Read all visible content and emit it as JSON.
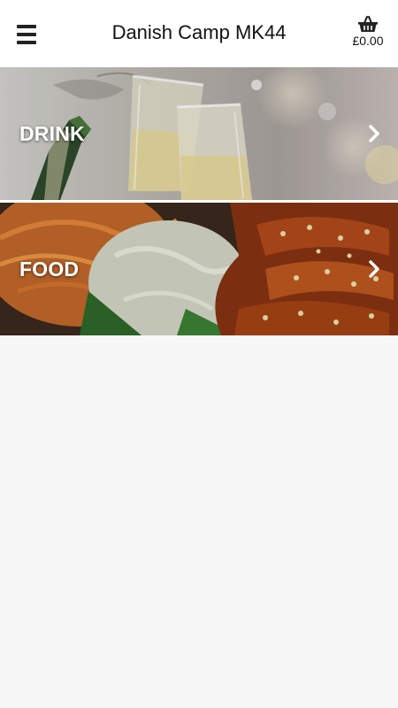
{
  "header": {
    "title": "Danish Camp MK44",
    "basket_total": "£0.00",
    "menu_icon": "hamburger-menu-icon",
    "basket_icon": "basket-icon"
  },
  "categories": [
    {
      "label": "DRINK",
      "icon": "chevron-right-icon"
    },
    {
      "label": "FOOD",
      "icon": "chevron-right-icon"
    }
  ]
}
